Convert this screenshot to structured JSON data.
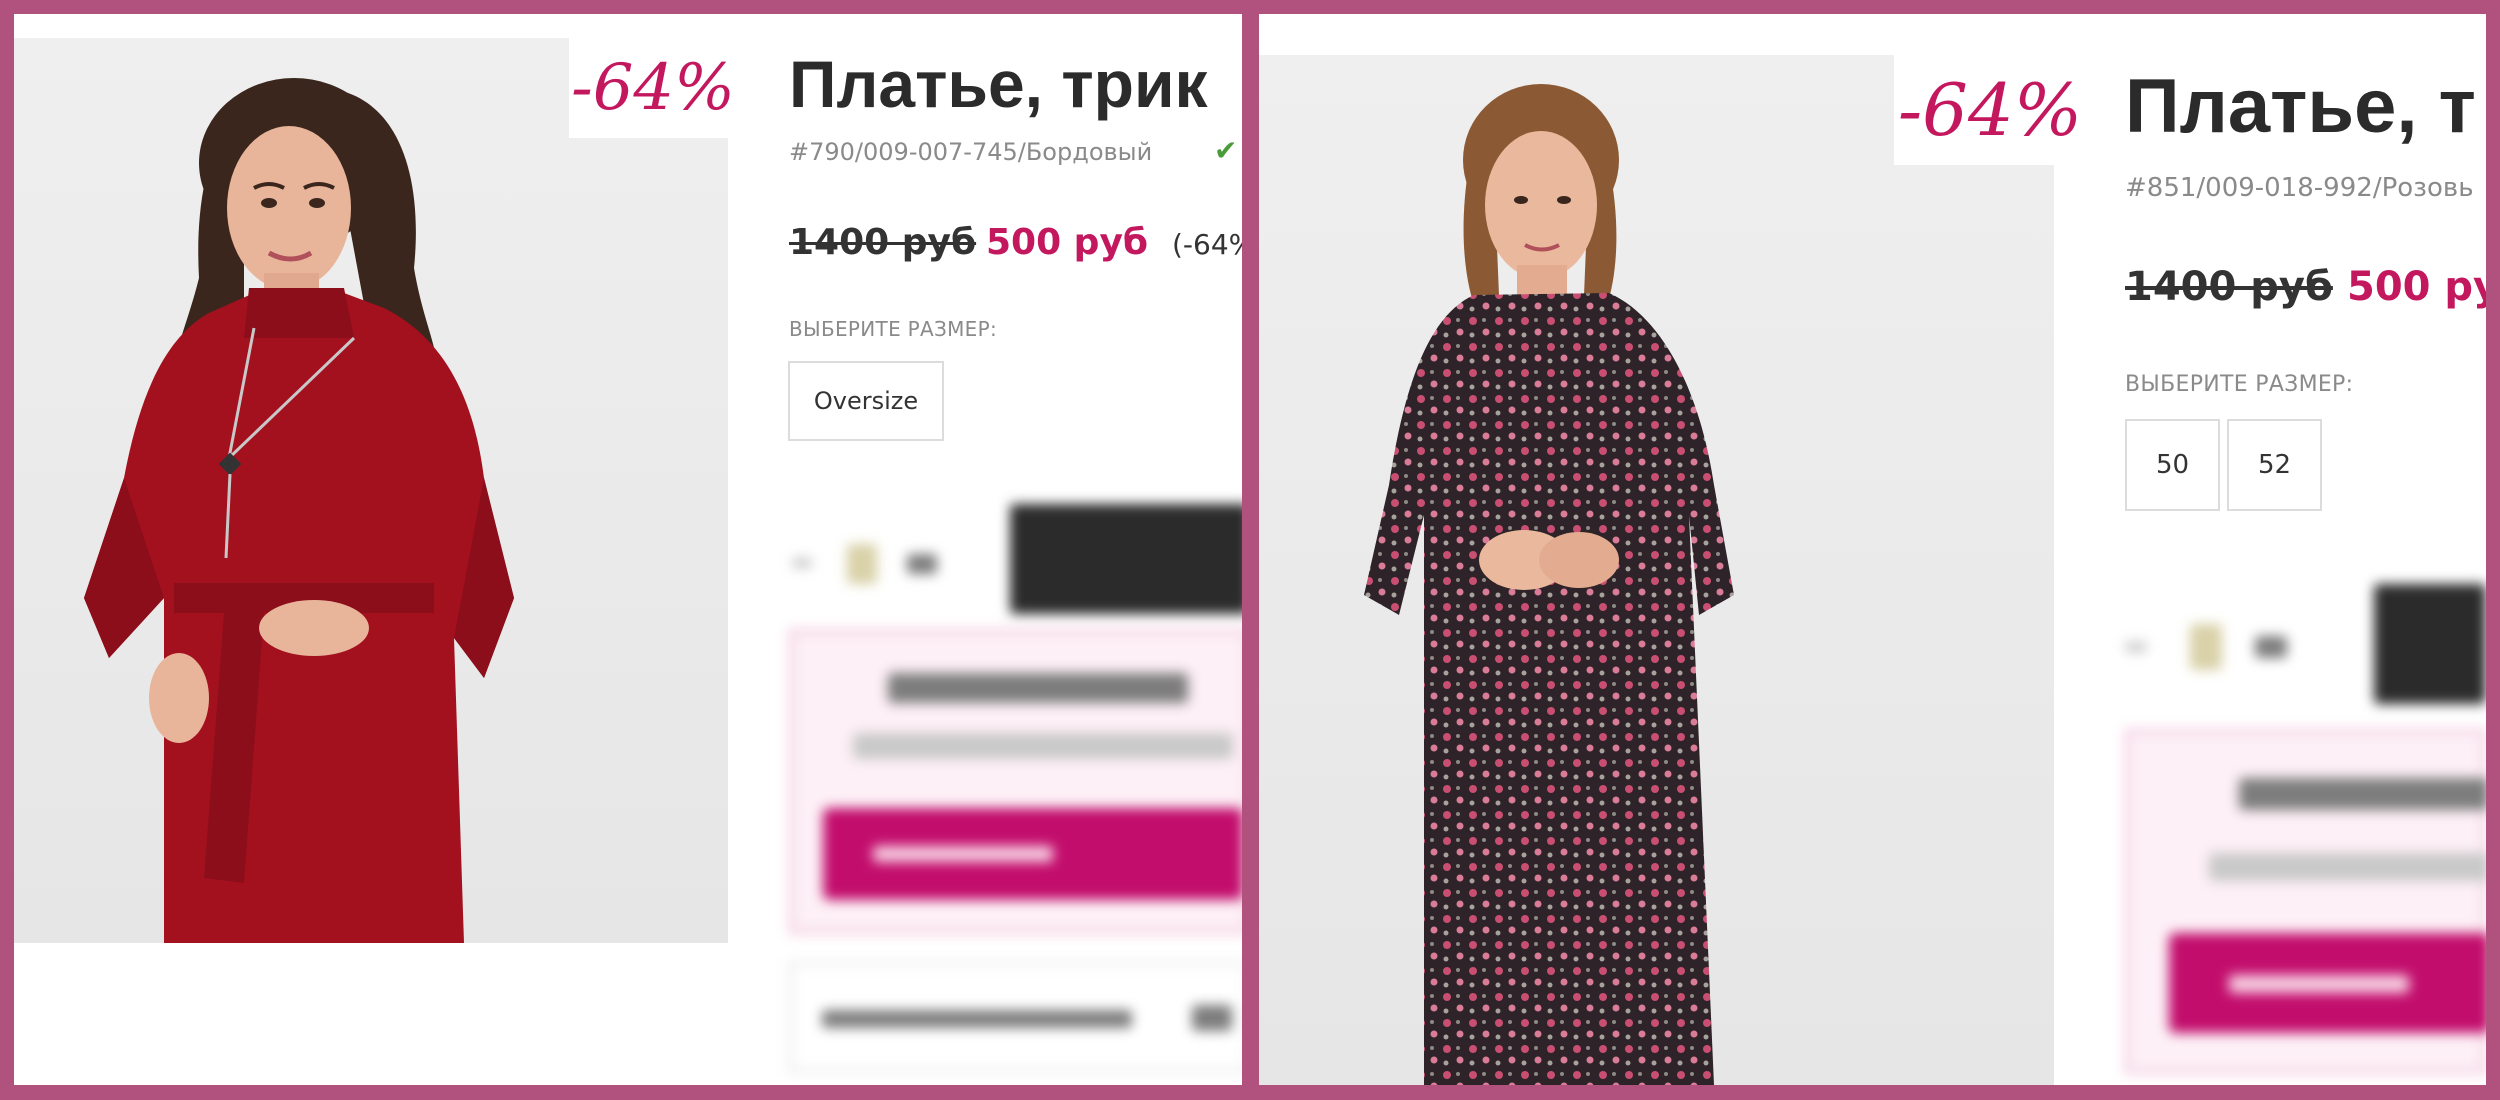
{
  "left": {
    "discount_badge": "-64%",
    "title": "Платье, трик",
    "sku": "#790/009-007-745/Бордовый",
    "price_old": "1400 руб",
    "price_new": "500 руб",
    "price_discount": "(-64%",
    "size_label": "ВЫБЕРИТЕ РАЗМЕР:",
    "sizes": [
      "Oversize"
    ],
    "photo_icon": "model-red-dress-photo",
    "in_stock_icon": "checkmark-icon"
  },
  "right": {
    "discount_badge": "-64%",
    "title": "Платье, т",
    "sku": "#851/009-018-992/Розовь",
    "price_old": "1400 руб",
    "price_new": "500 ру",
    "size_label": "ВЫБЕРИТЕ РАЗМЕР:",
    "sizes": [
      "50",
      "52"
    ],
    "photo_icon": "model-floral-dress-photo"
  },
  "colors": {
    "frame": "#b0517e",
    "accent": "#c3185e",
    "promo_button": "#c20d6c",
    "dress_red": "#a3111f"
  }
}
